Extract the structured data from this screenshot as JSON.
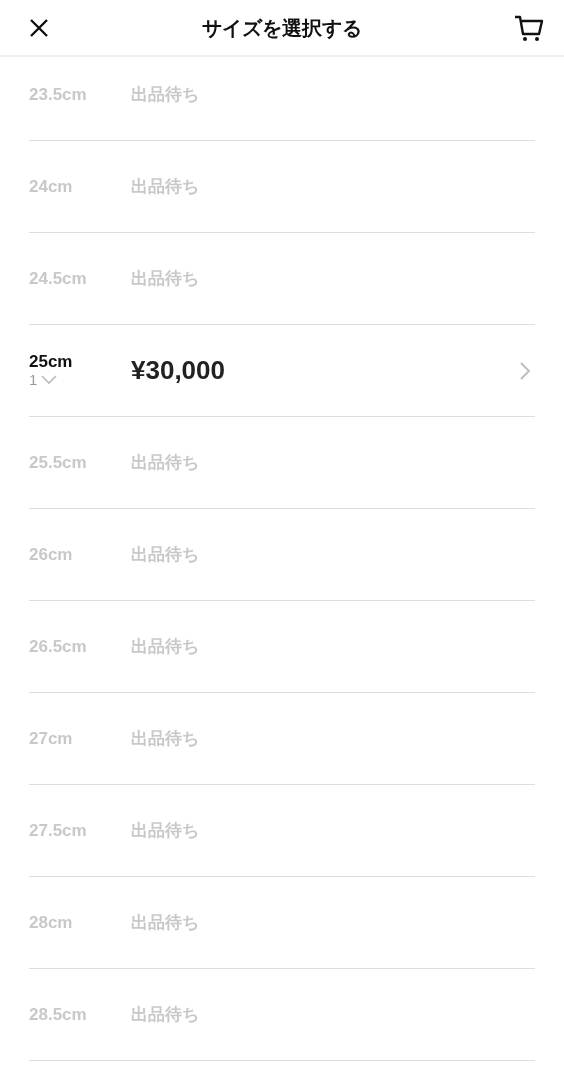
{
  "header": {
    "title": "サイズを選択する"
  },
  "sizes": [
    {
      "kind": "waiting",
      "size": "23.5cm",
      "status": "出品待ち"
    },
    {
      "kind": "waiting",
      "size": "24cm",
      "status": "出品待ち"
    },
    {
      "kind": "waiting",
      "size": "24.5cm",
      "status": "出品待ち"
    },
    {
      "kind": "available",
      "size": "25cm",
      "quantity": "1",
      "price": "¥30,000"
    },
    {
      "kind": "waiting",
      "size": "25.5cm",
      "status": "出品待ち"
    },
    {
      "kind": "waiting",
      "size": "26cm",
      "status": "出品待ち"
    },
    {
      "kind": "waiting",
      "size": "26.5cm",
      "status": "出品待ち"
    },
    {
      "kind": "waiting",
      "size": "27cm",
      "status": "出品待ち"
    },
    {
      "kind": "waiting",
      "size": "27.5cm",
      "status": "出品待ち"
    },
    {
      "kind": "waiting",
      "size": "28cm",
      "status": "出品待ち"
    },
    {
      "kind": "waiting",
      "size": "28.5cm",
      "status": "出品待ち"
    }
  ]
}
